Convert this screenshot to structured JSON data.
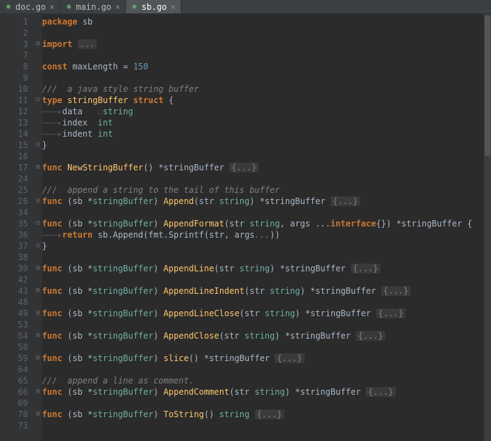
{
  "tabs": [
    {
      "name": "doc.go",
      "icon_color": "#6aab73",
      "active": false
    },
    {
      "name": "main.go",
      "icon_color": "#6aab73",
      "active": false
    },
    {
      "name": "sb.go",
      "icon_color": "#6aab73",
      "active": true
    }
  ],
  "lines": [
    {
      "num": "1",
      "fold": "",
      "tokens": [
        [
          "kw",
          "package"
        ],
        [
          "punct",
          " "
        ],
        [
          "pkg",
          "sb"
        ]
      ]
    },
    {
      "num": "2",
      "fold": "",
      "tokens": []
    },
    {
      "num": "3",
      "fold": "+",
      "tokens": [
        [
          "kw",
          "import"
        ],
        [
          "punct",
          " "
        ],
        [
          "folded",
          "..."
        ]
      ]
    },
    {
      "num": "7",
      "fold": "",
      "tokens": []
    },
    {
      "num": "8",
      "fold": "",
      "tokens": [
        [
          "kw",
          "const"
        ],
        [
          "punct",
          " "
        ],
        [
          "ident",
          "maxLength"
        ],
        [
          "punct",
          " = "
        ],
        [
          "num",
          "150"
        ]
      ]
    },
    {
      "num": "9",
      "fold": "",
      "tokens": []
    },
    {
      "num": "10",
      "fold": "",
      "tokens": [
        [
          "cmt",
          "///  a java style string buffer"
        ]
      ]
    },
    {
      "num": "11",
      "fold": "-",
      "tokens": [
        [
          "kw",
          "type"
        ],
        [
          "punct",
          " "
        ],
        [
          "yellow",
          "stringBuffer"
        ],
        [
          "punct",
          " "
        ],
        [
          "kw",
          "struct"
        ],
        [
          "punct",
          " {"
        ]
      ]
    },
    {
      "num": "12",
      "fold": "",
      "tokens": [
        [
          "ws",
          "———▸"
        ],
        [
          "ident",
          "data"
        ],
        [
          "punct",
          "   "
        ],
        [
          "ws",
          "☐"
        ],
        [
          "type",
          "string"
        ]
      ]
    },
    {
      "num": "13",
      "fold": "",
      "tokens": [
        [
          "ws",
          "———▸"
        ],
        [
          "ident",
          "index"
        ],
        [
          "punct",
          "  "
        ],
        [
          "type",
          "int"
        ]
      ]
    },
    {
      "num": "14",
      "fold": "",
      "tokens": [
        [
          "ws",
          "———▸"
        ],
        [
          "ident",
          "indent"
        ],
        [
          "punct",
          " "
        ],
        [
          "type",
          "int"
        ]
      ]
    },
    {
      "num": "15",
      "fold": "-",
      "tokens": [
        [
          "punct",
          "}"
        ]
      ]
    },
    {
      "num": "16",
      "fold": "",
      "tokens": []
    },
    {
      "num": "17",
      "fold": "+",
      "tokens": [
        [
          "kw",
          "func"
        ],
        [
          "punct",
          " "
        ],
        [
          "fn",
          "NewStringBuffer"
        ],
        [
          "punct",
          "() *stringBuffer "
        ],
        [
          "folded",
          "{...}"
        ]
      ]
    },
    {
      "num": "24",
      "fold": "",
      "tokens": []
    },
    {
      "num": "25",
      "fold": "",
      "tokens": [
        [
          "cmt",
          "///  append a string to the tail of this buffer"
        ]
      ]
    },
    {
      "num": "26",
      "fold": "+",
      "tokens": [
        [
          "kw",
          "func"
        ],
        [
          "punct",
          " (sb *"
        ],
        [
          "type",
          "stringBuffer"
        ],
        [
          "punct",
          ") "
        ],
        [
          "fn",
          "Append"
        ],
        [
          "punct",
          "(str "
        ],
        [
          "type",
          "string"
        ],
        [
          "punct",
          ") *stringBuffer "
        ],
        [
          "folded",
          "{...}"
        ]
      ]
    },
    {
      "num": "34",
      "fold": "",
      "tokens": []
    },
    {
      "num": "35",
      "fold": "-",
      "tokens": [
        [
          "kw",
          "func"
        ],
        [
          "punct",
          " (sb *"
        ],
        [
          "type",
          "stringBuffer"
        ],
        [
          "punct",
          ") "
        ],
        [
          "fn",
          "AppendFormat"
        ],
        [
          "punct",
          "(str "
        ],
        [
          "type",
          "string"
        ],
        [
          "punct",
          ", args ..."
        ],
        [
          "kw",
          "interface"
        ],
        [
          "punct",
          "{}) *stringBuffer {"
        ]
      ]
    },
    {
      "num": "36",
      "fold": "",
      "tokens": [
        [
          "ws",
          "———▸"
        ],
        [
          "kw",
          "return"
        ],
        [
          "punct",
          " sb."
        ],
        [
          "ident",
          "Append"
        ],
        [
          "punct",
          "("
        ],
        [
          "ident",
          "fmt"
        ],
        [
          "punct",
          "."
        ],
        [
          "ident",
          "Sprintf"
        ],
        [
          "punct",
          "("
        ],
        [
          "ident",
          "str"
        ],
        [
          "punct",
          ", args"
        ],
        [
          "cmt",
          "..."
        ],
        [
          "punct",
          "))"
        ]
      ]
    },
    {
      "num": "37",
      "fold": "-",
      "tokens": [
        [
          "punct",
          "}"
        ]
      ]
    },
    {
      "num": "38",
      "fold": "",
      "tokens": []
    },
    {
      "num": "39",
      "fold": "+",
      "tokens": [
        [
          "kw",
          "func"
        ],
        [
          "punct",
          " (sb *"
        ],
        [
          "type",
          "stringBuffer"
        ],
        [
          "punct",
          ") "
        ],
        [
          "fn",
          "AppendLine"
        ],
        [
          "punct",
          "(str "
        ],
        [
          "type",
          "string"
        ],
        [
          "punct",
          ") *stringBuffer "
        ],
        [
          "folded",
          "{...}"
        ]
      ]
    },
    {
      "num": "42",
      "fold": "",
      "tokens": []
    },
    {
      "num": "43",
      "fold": "+",
      "tokens": [
        [
          "kw",
          "func"
        ],
        [
          "punct",
          " (sb *"
        ],
        [
          "type",
          "stringBuffer"
        ],
        [
          "punct",
          ") "
        ],
        [
          "fn",
          "AppendLineIndent"
        ],
        [
          "punct",
          "(str "
        ],
        [
          "type",
          "string"
        ],
        [
          "punct",
          ") *stringBuffer "
        ],
        [
          "folded",
          "{...}"
        ]
      ]
    },
    {
      "num": "48",
      "fold": "",
      "tokens": []
    },
    {
      "num": "49",
      "fold": "+",
      "tokens": [
        [
          "kw",
          "func"
        ],
        [
          "punct",
          " (sb *"
        ],
        [
          "type",
          "stringBuffer"
        ],
        [
          "punct",
          ") "
        ],
        [
          "fn",
          "AppendLineClose"
        ],
        [
          "punct",
          "(str "
        ],
        [
          "type",
          "string"
        ],
        [
          "punct",
          ") *stringBuffer "
        ],
        [
          "folded",
          "{...}"
        ]
      ]
    },
    {
      "num": "53",
      "fold": "",
      "tokens": []
    },
    {
      "num": "54",
      "fold": "+",
      "tokens": [
        [
          "kw",
          "func"
        ],
        [
          "punct",
          " (sb *"
        ],
        [
          "type",
          "stringBuffer"
        ],
        [
          "punct",
          ") "
        ],
        [
          "fn",
          "AppendClose"
        ],
        [
          "punct",
          "(str "
        ],
        [
          "type",
          "string"
        ],
        [
          "punct",
          ") *stringBuffer "
        ],
        [
          "folded",
          "{...}"
        ]
      ]
    },
    {
      "num": "58",
      "fold": "",
      "tokens": []
    },
    {
      "num": "59",
      "fold": "+",
      "tokens": [
        [
          "kw",
          "func"
        ],
        [
          "punct",
          " (sb *"
        ],
        [
          "type",
          "stringBuffer"
        ],
        [
          "punct",
          ") "
        ],
        [
          "fn",
          "slice"
        ],
        [
          "punct",
          "() *stringBuffer "
        ],
        [
          "folded",
          "{...}"
        ]
      ]
    },
    {
      "num": "64",
      "fold": "",
      "tokens": []
    },
    {
      "num": "65",
      "fold": "",
      "tokens": [
        [
          "cmt",
          "///  append a line as comment."
        ]
      ]
    },
    {
      "num": "66",
      "fold": "+",
      "tokens": [
        [
          "kw",
          "func"
        ],
        [
          "punct",
          " (sb *"
        ],
        [
          "type",
          "stringBuffer"
        ],
        [
          "punct",
          ") "
        ],
        [
          "fn",
          "AppendComment"
        ],
        [
          "punct",
          "(str "
        ],
        [
          "type",
          "string"
        ],
        [
          "punct",
          ") *stringBuffer "
        ],
        [
          "folded",
          "{...}"
        ]
      ]
    },
    {
      "num": "69",
      "fold": "",
      "tokens": []
    },
    {
      "num": "70",
      "fold": "+",
      "tokens": [
        [
          "kw",
          "func"
        ],
        [
          "punct",
          " (sb *"
        ],
        [
          "type",
          "stringBuffer"
        ],
        [
          "punct",
          ") "
        ],
        [
          "fn",
          "ToString"
        ],
        [
          "punct",
          "() "
        ],
        [
          "type",
          "string"
        ],
        [
          "punct",
          " "
        ],
        [
          "folded",
          "{...}"
        ]
      ]
    },
    {
      "num": "73",
      "fold": "",
      "tokens": []
    }
  ]
}
